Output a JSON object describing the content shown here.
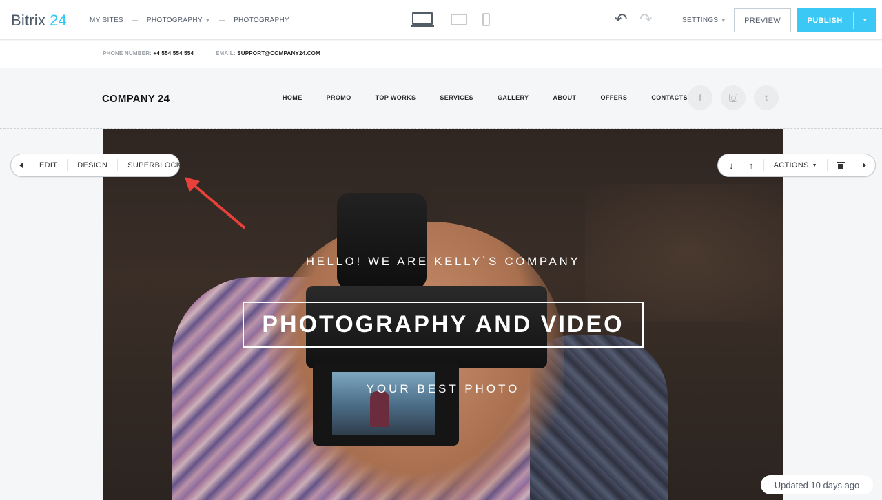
{
  "app": {
    "logo_name": "Bitrix",
    "logo_num": "24",
    "breadcrumbs": [
      "MY SITES",
      "PHOTOGRAPHY",
      "PHOTOGRAPHY"
    ],
    "settings_label": "SETTINGS",
    "preview_label": "PREVIEW",
    "publish_label": "PUBLISH",
    "accent_color": "#3bc8f5"
  },
  "contacts": {
    "phone_label": "PHONE NUMBER:",
    "phone_value": "+4 554 554 554",
    "email_label": "EMAIL:",
    "email_value": "SUPPORT@COMPANY24.COM"
  },
  "site": {
    "company": "COMPANY 24",
    "nav": [
      "HOME",
      "PROMO",
      "TOP WORKS",
      "SERVICES",
      "GALLERY",
      "ABOUT",
      "OFFERS",
      "CONTACTS"
    ],
    "social_icons": [
      "facebook-icon",
      "instagram-icon",
      "twitter-icon"
    ],
    "twitter_glyph": "t"
  },
  "hero": {
    "subtitle_top": "HELLO! WE ARE KELLY`S COMPANY",
    "title": "PHOTOGRAPHY AND VIDEO",
    "subtitle_bottom": "YOUR BEST PHOTO"
  },
  "block_toolbar_left": {
    "edit": "EDIT",
    "design": "DESIGN",
    "superblock": "SUPERBLOCK"
  },
  "block_toolbar_right": {
    "actions": "ACTIONS"
  },
  "status": {
    "updated": "Updated 10 days ago"
  }
}
